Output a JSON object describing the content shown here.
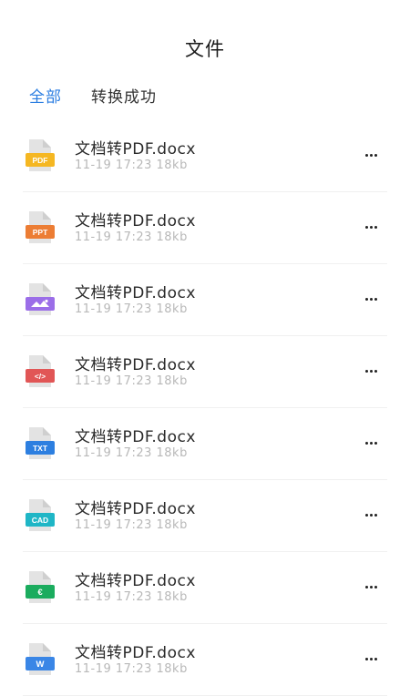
{
  "header": {
    "title": "文件"
  },
  "tabs": [
    {
      "label": "全部",
      "active": true
    },
    {
      "label": "转换成功",
      "active": false
    }
  ],
  "files": [
    {
      "type": "pdf",
      "badge": "PDF",
      "color": "#f5b722",
      "name": "文档转PDF.docx",
      "meta": "11-19 17:23 18kb"
    },
    {
      "type": "ppt",
      "badge": "PPT",
      "color": "#ec7d34",
      "name": "文档转PDF.docx",
      "meta": "11-19 17:23 18kb"
    },
    {
      "type": "image",
      "badge": "",
      "color": "#9b6ee8",
      "name": "文档转PDF.docx",
      "meta": "11-19 17:23 18kb"
    },
    {
      "type": "code",
      "badge": "</>",
      "color": "#e15656",
      "name": "文档转PDF.docx",
      "meta": "11-19 17:23 18kb"
    },
    {
      "type": "txt",
      "badge": "TXT",
      "color": "#2d7fe0",
      "name": "文档转PDF.docx",
      "meta": "11-19 17:23 18kb"
    },
    {
      "type": "cad",
      "badge": "CAD",
      "color": "#1fb6c6",
      "name": "文档转PDF.docx",
      "meta": "11-19 17:23 18kb"
    },
    {
      "type": "money",
      "badge": "€",
      "color": "#1bac5e",
      "name": "文档转PDF.docx",
      "meta": "11-19 17:23 18kb"
    },
    {
      "type": "word",
      "badge": "W",
      "color": "#3a86e6",
      "name": "文档转PDF.docx",
      "meta": "11-19 17:23 18kb"
    }
  ]
}
